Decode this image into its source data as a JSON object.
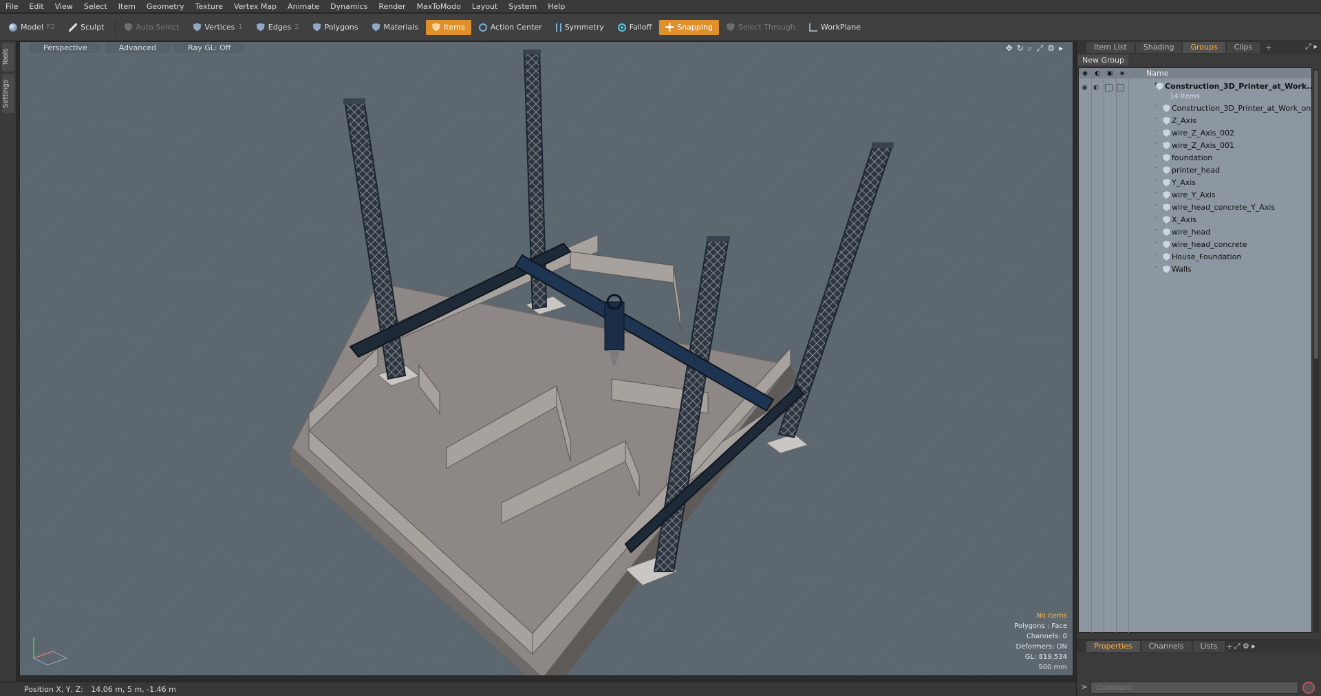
{
  "menu": [
    "File",
    "Edit",
    "View",
    "Select",
    "Item",
    "Geometry",
    "Texture",
    "Vertex Map",
    "Animate",
    "Dynamics",
    "Render",
    "MaxToModo",
    "Layout",
    "System",
    "Help"
  ],
  "toolbar": {
    "model": "Model",
    "model_key": "F2",
    "sculpt": "Sculpt",
    "auto_select": "Auto Select",
    "vertices": "Vertices",
    "vertices_key": "1",
    "edges": "Edges",
    "edges_key": "2",
    "polygons": "Polygons",
    "materials": "Materials",
    "items": "Items",
    "action_center": "Action Center",
    "symmetry": "Symmetry",
    "falloff": "Falloff",
    "snapping": "Snapping",
    "select_through": "Select Through",
    "workplane": "WorkPlane"
  },
  "left_tabs": [
    "Tools",
    "Settings"
  ],
  "viewport": {
    "view_mode": "Perspective",
    "shading": "Advanced",
    "raygl": "Ray GL: Off",
    "info": {
      "selection": "No Items",
      "polygons": "Polygons : Face",
      "channels": "Channels: 0",
      "deformers": "Deformers: ON",
      "gl": "GL: 819,534",
      "unit": "500 mm"
    },
    "colors": {
      "background": "#5c6770",
      "frame": "#1d2a3a",
      "concrete": "#9a9593"
    }
  },
  "status": {
    "position_label": "Position X, Y, Z:",
    "position_value": "14.06 m, 5 m, -1.46 m"
  },
  "right_panel": {
    "tabs": [
      "Item List",
      "Shading",
      "Groups",
      "Clips"
    ],
    "active_tab": "Groups",
    "new_group": "New Group",
    "column_name": "Name",
    "root": "Construction_3D_Printer_at_Work...",
    "root_count": "14 Items",
    "items": [
      "Construction_3D_Printer_at_Work_on...",
      "Z_Axis",
      "wire_Z_Axis_002",
      "wire_Z_Axis_001",
      "foundation",
      "printer_head",
      "Y_Axis",
      "wire_Y_Axis",
      "wire_head_concrete_Y_Axis",
      "X_Axis",
      "wire_head",
      "wire_head_concrete",
      "House_Foundation",
      "Walls"
    ]
  },
  "bottom_panel": {
    "tabs": [
      "Properties",
      "Channels",
      "Lists"
    ],
    "active_tab": "Properties",
    "command_placeholder": "Command"
  },
  "accent_color": "#e0902a"
}
